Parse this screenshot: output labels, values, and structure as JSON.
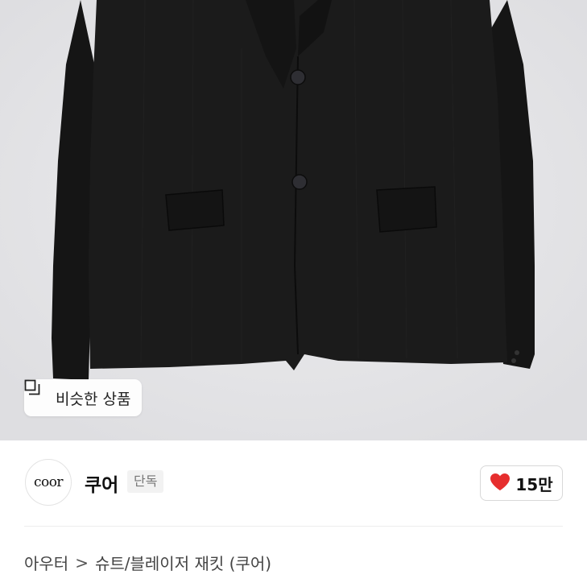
{
  "product": {
    "similar_button_label": "비슷한 상품"
  },
  "brand": {
    "logo_text": "coor",
    "name": "쿠어",
    "badge": "단독"
  },
  "likes": {
    "count": "15만",
    "icon": "heart-icon",
    "color": "#e62e2e"
  },
  "breadcrumb": {
    "category": "아우터",
    "separator": ">",
    "subcategory": "슈트/블레이저 재킷 (쿠어)"
  }
}
